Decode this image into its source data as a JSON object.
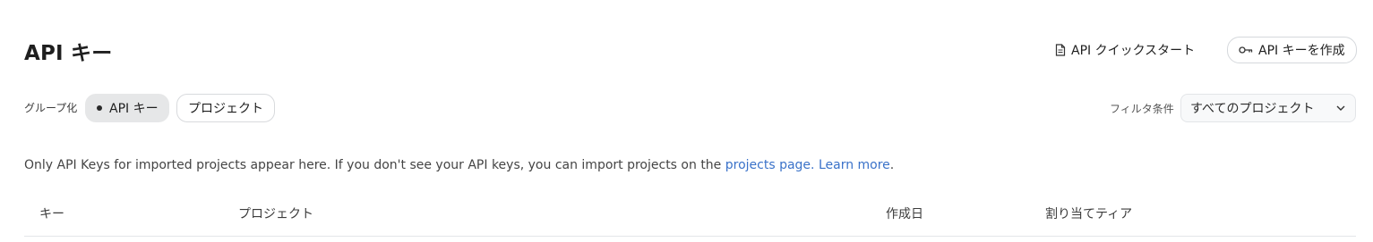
{
  "page": {
    "title": "API キー"
  },
  "header": {
    "quickstart_label": "API クイックスタート",
    "quickstart_icon": "document-icon",
    "create_label": "API キーを作成",
    "create_icon": "key-icon"
  },
  "toolbar": {
    "group_label": "グループ化",
    "group_options": [
      {
        "label": "API キー",
        "selected": true
      },
      {
        "label": "プロジェクト",
        "selected": false
      }
    ],
    "filter_label": "フィルタ条件",
    "filter_value": "すべてのプロジェクト"
  },
  "notice": {
    "text": "Only API Keys for imported projects appear here. If you don't see your API keys, you can import projects on the ",
    "link1": "projects page.",
    "link2": "Learn more",
    "tail": "."
  },
  "table": {
    "columns": [
      "キー",
      "プロジェクト",
      "作成日",
      "割り当てティア"
    ]
  },
  "colors": {
    "link": "#3a72c9",
    "chip_selected_bg": "#e6e7e8"
  }
}
